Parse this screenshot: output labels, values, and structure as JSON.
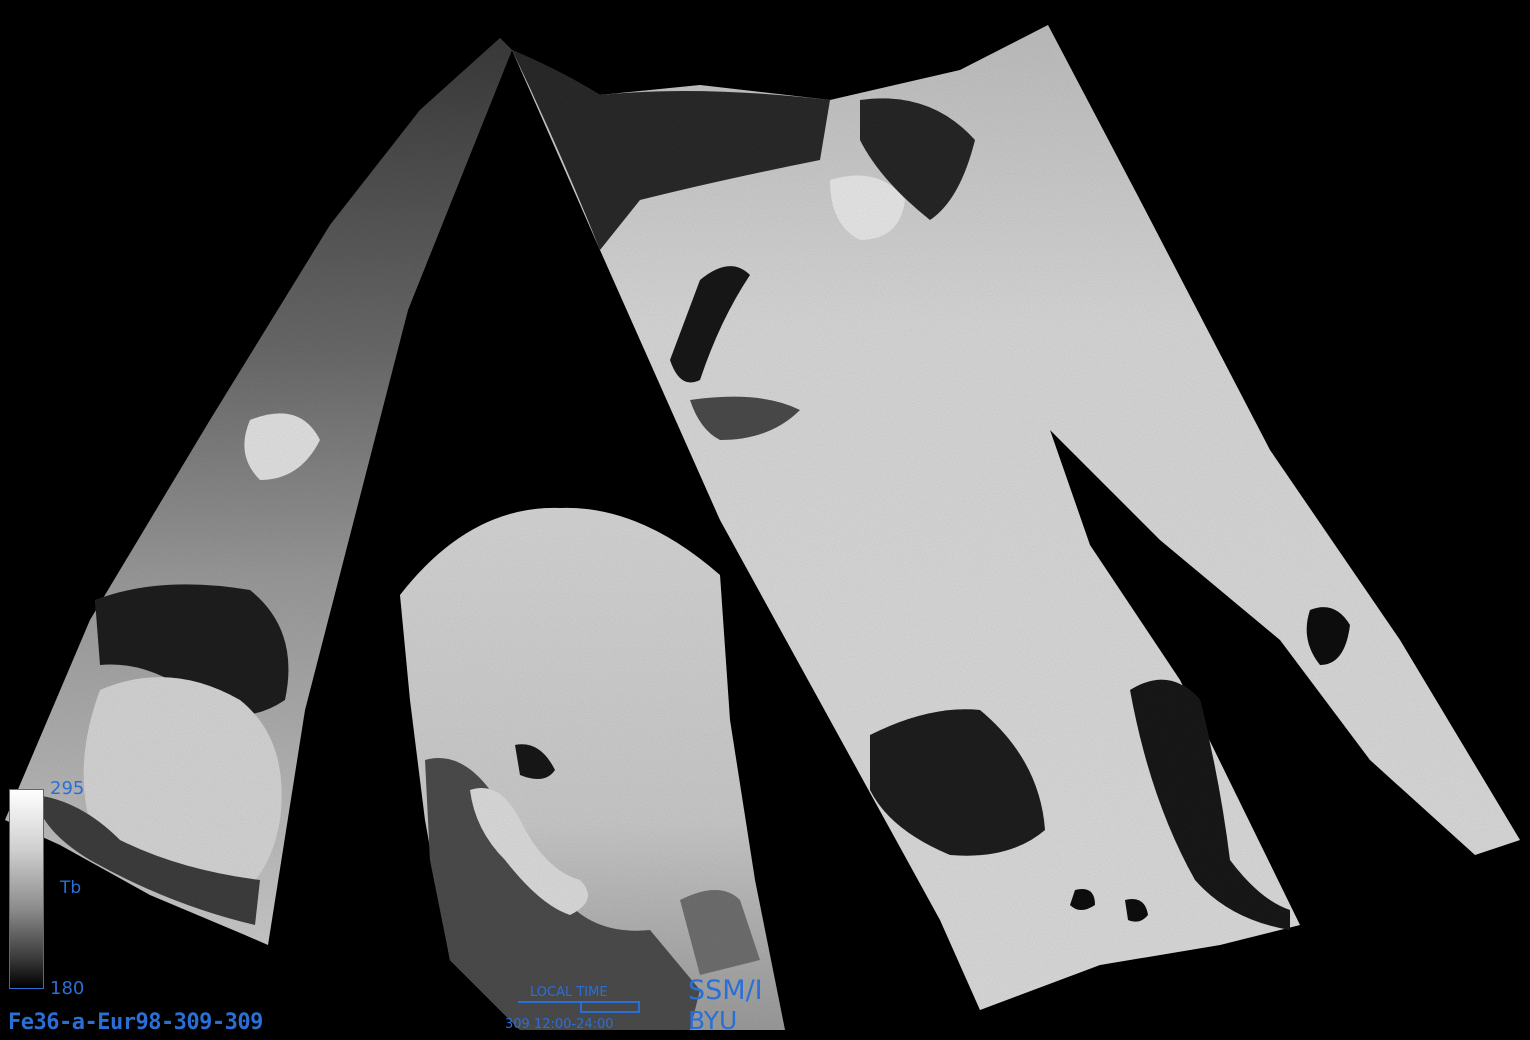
{
  "colorbar": {
    "max": "295",
    "unit": "Tb",
    "min": "180"
  },
  "product_id": "Fe36-a-Eur98-309-309",
  "local_time": {
    "title": "LOCAL TIME",
    "range": "309 12:00-24:00"
  },
  "sensor": "SSM/I",
  "org": "BYU",
  "colors": {
    "label": "#2a6fd6",
    "background": "#000000"
  }
}
